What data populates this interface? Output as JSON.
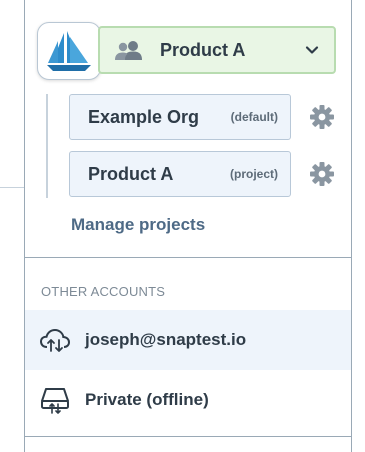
{
  "switcher": {
    "current_project": "Product A",
    "orgs": [
      {
        "name": "Example Org",
        "tag": "(default)"
      },
      {
        "name": "Product A",
        "tag": "(project)"
      }
    ],
    "manage_link": "Manage projects"
  },
  "other_accounts": {
    "heading": "OTHER ACCOUNTS",
    "items": [
      {
        "label": "joseph@snaptest.io",
        "icon": "cloud-sync-icon"
      },
      {
        "label": "Private (offline)",
        "icon": "local-drive-icon"
      }
    ]
  },
  "colors": {
    "selector_bg": "#e9f6e5",
    "selector_border": "#b8dcb0",
    "item_bg": "#eef4fb",
    "link": "#4e6a86",
    "logo_blue": "#2e8ccb"
  }
}
